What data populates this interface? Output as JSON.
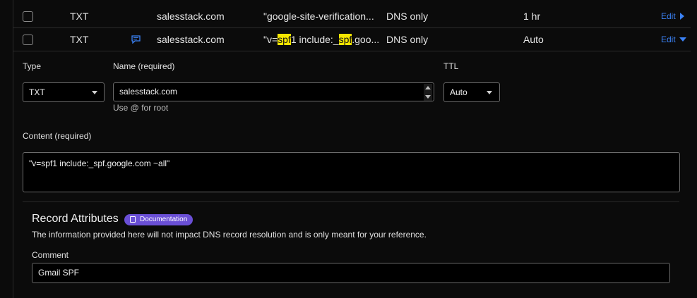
{
  "records": [
    {
      "type": "TXT",
      "name": "salesstack.com",
      "content": "\"google-site-verification...",
      "proxy": "DNS only",
      "ttl": "1 hr",
      "edit_label": "Edit"
    },
    {
      "type": "TXT",
      "name": "salesstack.com",
      "content_parts": [
        "\"v=",
        "spf",
        "1 include:_",
        "spf",
        ".goo..."
      ],
      "proxy": "DNS only",
      "ttl": "Auto",
      "edit_label": "Edit"
    }
  ],
  "editor": {
    "type_label": "Type",
    "type_value": "TXT",
    "name_label": "Name (required)",
    "name_value": "salesstack.com",
    "name_help": "Use @ for root",
    "ttl_label": "TTL",
    "ttl_value": "Auto",
    "content_label": "Content (required)",
    "content_value": "\"v=spf1 include:_spf.google.com ~all\""
  },
  "attributes": {
    "title": "Record Attributes",
    "doc_badge": "Documentation",
    "description": "The information provided here will not impact DNS record resolution and is only meant for your reference.",
    "comment_label": "Comment",
    "comment_value": "Gmail SPF"
  },
  "colors": {
    "accent": "#3b82f6",
    "highlight": "#f6e600",
    "badge": "#6a4fd6"
  }
}
